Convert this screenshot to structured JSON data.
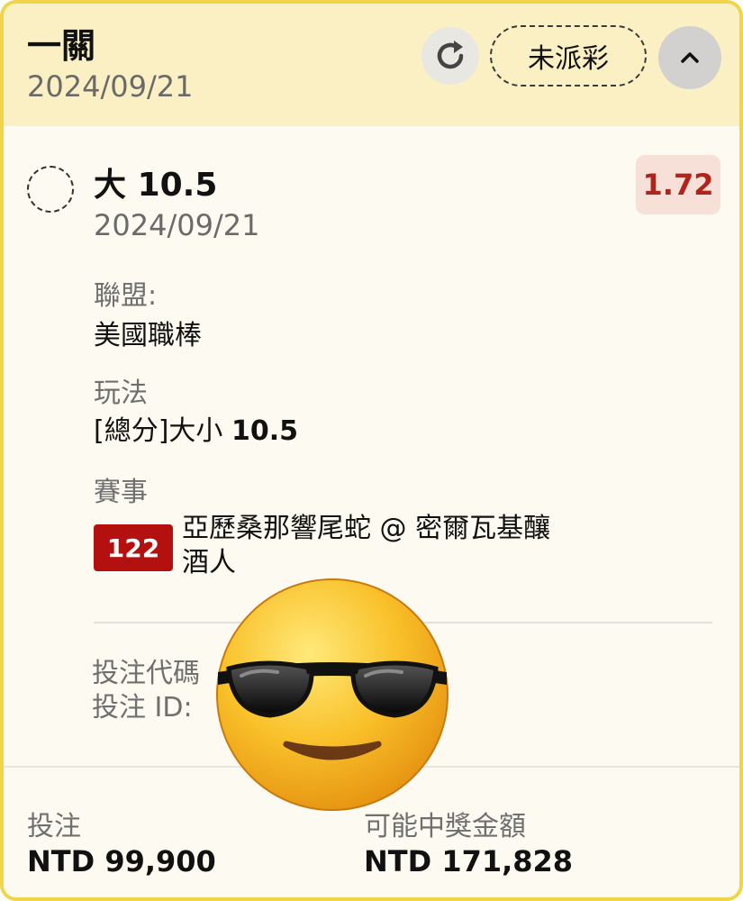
{
  "header": {
    "title": "一關",
    "date": "2024/09/21",
    "status": "未派彩"
  },
  "bet": {
    "selection_prefix": "大",
    "selection_line": "10.5",
    "date": "2024/09/21",
    "odds": "1.72",
    "league_label": "聯盟:",
    "league_value": "美國職棒",
    "market_label": "玩法",
    "market_text": "[總分]大小",
    "market_line": "10.5",
    "event_label": "賽事",
    "event_number": "122",
    "event_line1": "亞歷桑那響尾蛇 @ 密爾瓦基釀",
    "event_line2": "酒人",
    "code_label": "投注代碼",
    "id_label": "投注 ID:"
  },
  "footer": {
    "stake_label": "投注",
    "stake_value": "NTD 99,900",
    "payout_label": "可能中獎金額",
    "payout_value": "NTD 171,828"
  },
  "icons": {
    "refresh": "refresh-icon",
    "collapse": "chevron-up-icon",
    "overlay": "sunglasses-emoji"
  },
  "colors": {
    "border": "#f1d548",
    "header_bg": "#fbf0c4",
    "odds_text": "#b1241b",
    "event_badge": "#b4100f"
  }
}
